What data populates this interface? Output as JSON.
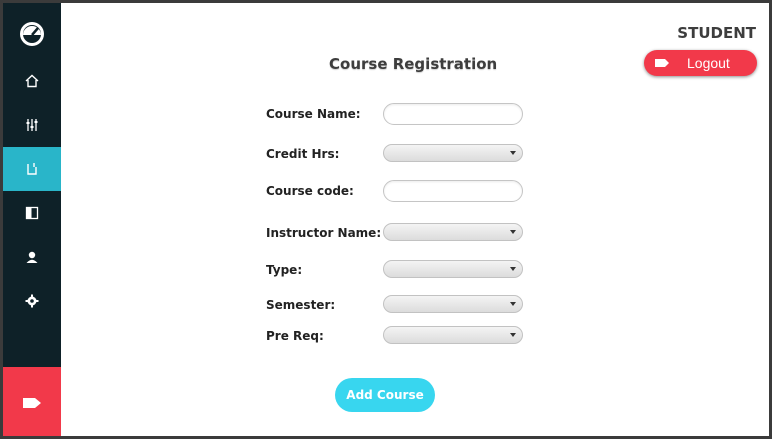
{
  "sidebar": {
    "items": [
      {
        "icon": "dashboard-gauge-icon"
      },
      {
        "icon": "home-icon"
      },
      {
        "icon": "sliders-icon"
      },
      {
        "icon": "register-course-icon",
        "active": true
      },
      {
        "icon": "book-icon"
      },
      {
        "icon": "user-icon"
      },
      {
        "icon": "settings-icon"
      }
    ],
    "logout_icon": "logout-tag-icon",
    "active_color": "#29b5c9",
    "background": "#0e2128"
  },
  "header": {
    "role": "STUDENT",
    "logout_label": "Logout",
    "logout_color": "#f2394a"
  },
  "form": {
    "title": "Course Registration",
    "fields": {
      "course_name": {
        "label": "Course Name:",
        "value": ""
      },
      "credit_hrs": {
        "label": "Credit Hrs:",
        "value": ""
      },
      "course_code": {
        "label": "Course code:",
        "value": ""
      },
      "instructor_name": {
        "label": "Instructor Name:",
        "value": ""
      },
      "type": {
        "label": "Type:",
        "value": ""
      },
      "semester": {
        "label": "Semester:",
        "value": ""
      },
      "pre_req": {
        "label": "Pre Req:",
        "value": ""
      }
    },
    "submit_label": "Add Course",
    "submit_color": "#38d6ef"
  }
}
